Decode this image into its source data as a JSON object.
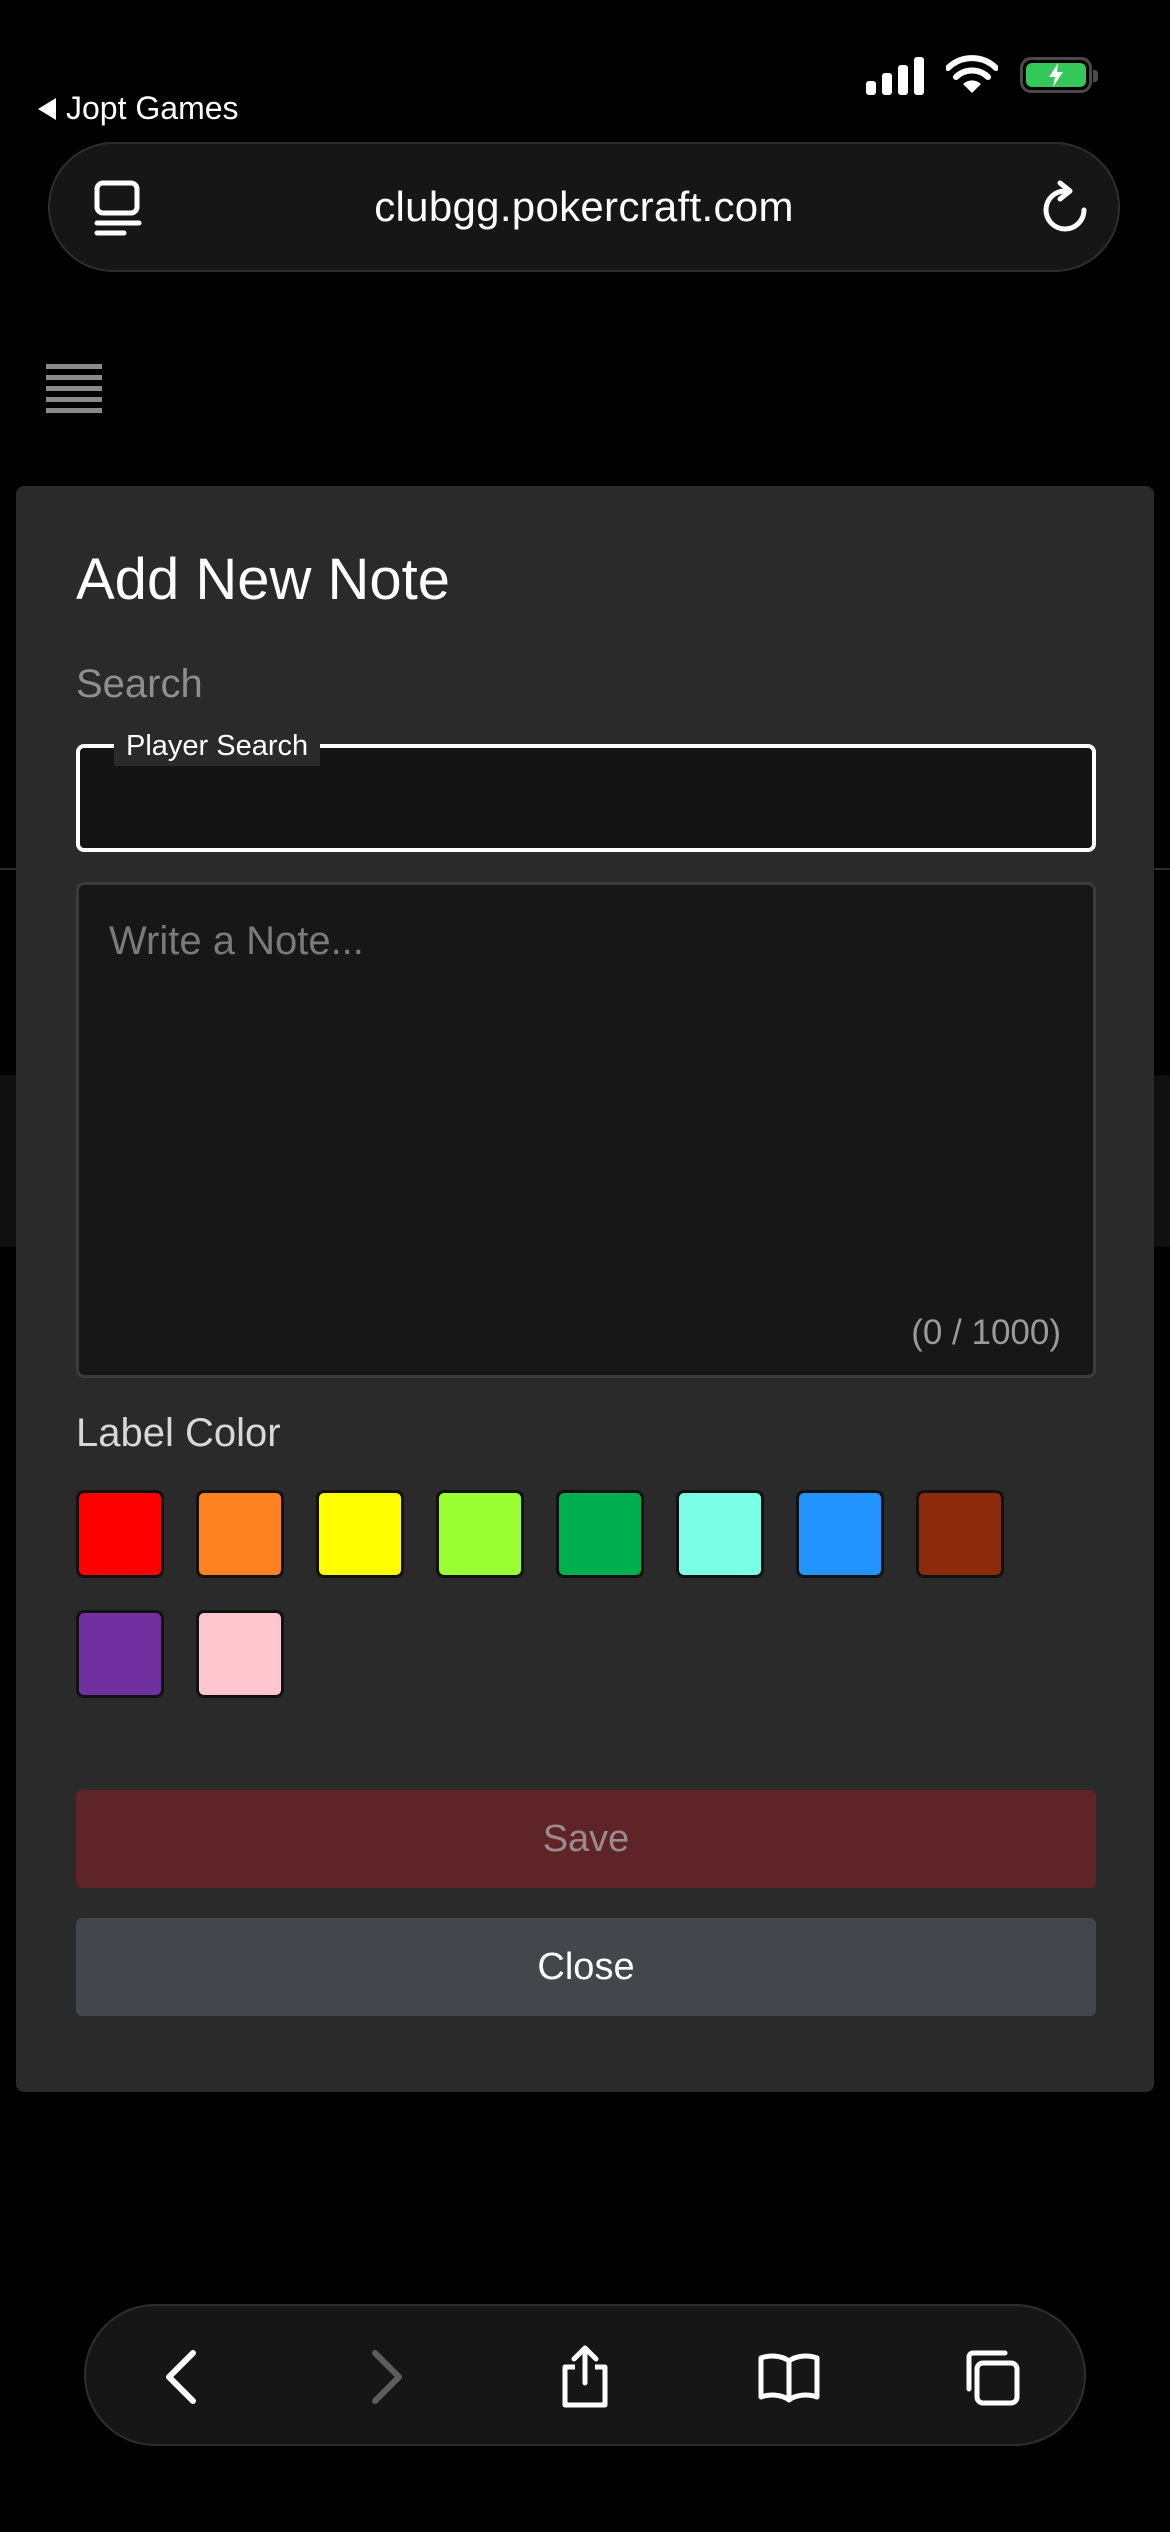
{
  "status_bar": {
    "back_app": "Jopt Games"
  },
  "browser": {
    "url": "clubgg.pokercraft.com"
  },
  "modal": {
    "title": "Add New Note",
    "search_label": "Search",
    "player_search_label": "Player Search",
    "player_search_value": "",
    "note_placeholder": "Write a Note...",
    "note_counter": "(0 / 1000)",
    "label_color_title": "Label Color",
    "colors": [
      "#ff0000",
      "#ff8221",
      "#ffff00",
      "#99ff33",
      "#00b050",
      "#7affe6",
      "#2394ff",
      "#8b2b0b",
      "#7030a0",
      "#ffc6d0"
    ],
    "save_label": "Save",
    "close_label": "Close"
  },
  "toolbar": {
    "items": [
      "back-icon",
      "forward-icon",
      "share-icon",
      "bookmarks-icon",
      "tabs-icon"
    ]
  }
}
